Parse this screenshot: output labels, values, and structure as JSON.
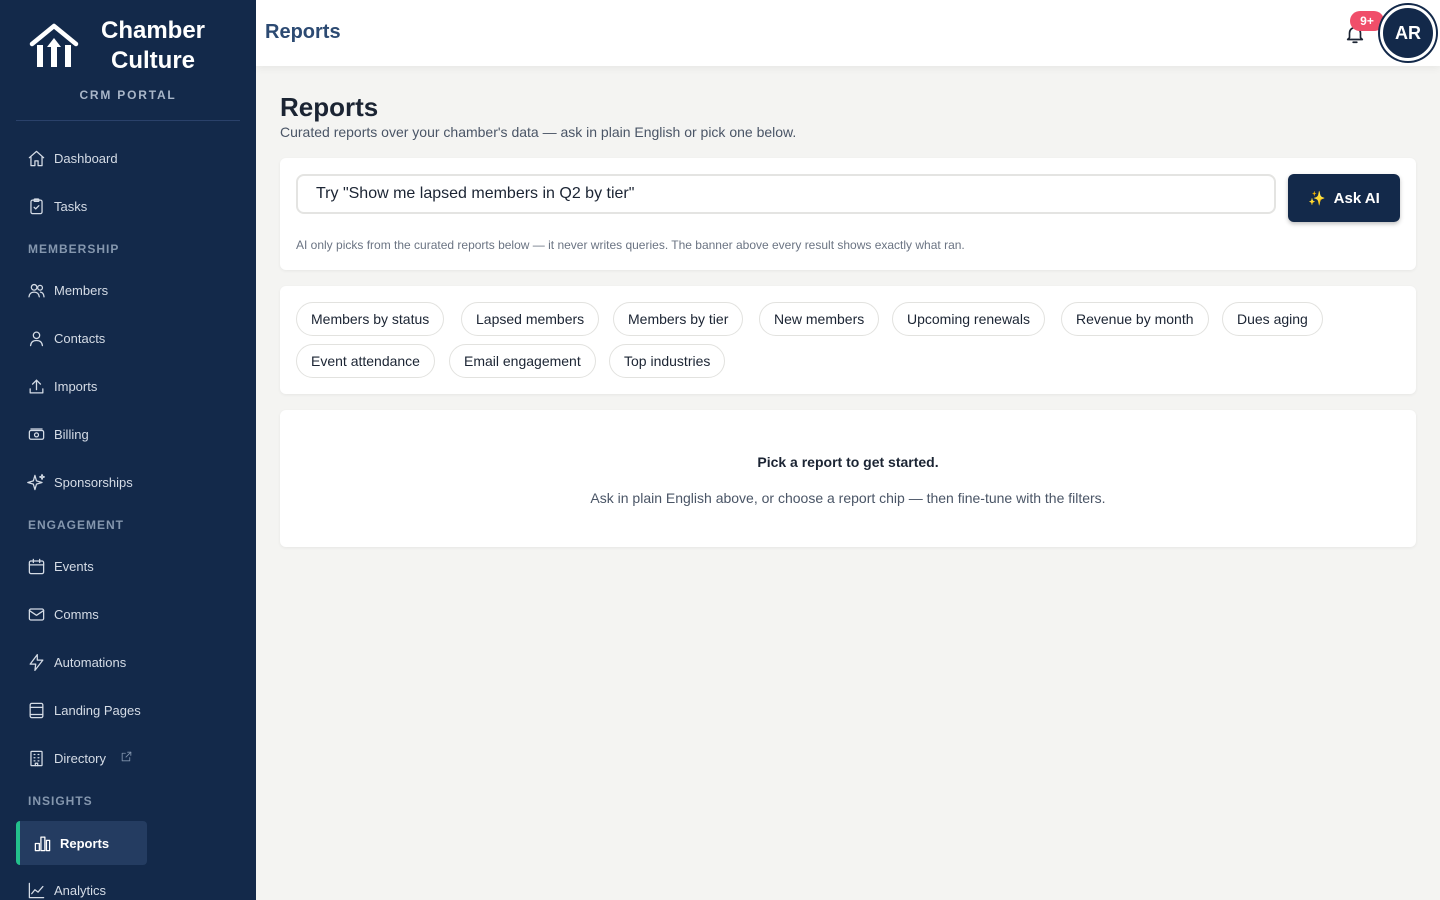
{
  "brand": {
    "name_line1": "Chamber",
    "name_line2": "Culture",
    "subtitle": "CRM PORTAL"
  },
  "sidebar": {
    "items": [
      {
        "label": "Dashboard",
        "icon": "home-icon"
      },
      {
        "label": "Tasks",
        "icon": "clipboard-check-icon"
      },
      {
        "label": "Members",
        "icon": "users-icon"
      },
      {
        "label": "Contacts",
        "icon": "user-icon"
      },
      {
        "label": "Imports",
        "icon": "upload-icon"
      },
      {
        "label": "Billing",
        "icon": "banknote-icon"
      },
      {
        "label": "Sponsorships",
        "icon": "sparkles-icon"
      },
      {
        "label": "Events",
        "icon": "calendar-icon"
      },
      {
        "label": "Comms",
        "icon": "mail-icon"
      },
      {
        "label": "Automations",
        "icon": "zap-icon"
      },
      {
        "label": "Landing Pages",
        "icon": "layout-icon"
      },
      {
        "label": "Directory",
        "icon": "building-icon"
      },
      {
        "label": "Reports",
        "icon": "bar-chart-icon",
        "active": true
      },
      {
        "label": "Analytics",
        "icon": "line-chart-icon"
      }
    ],
    "sections": {
      "membership": "MEMBERSHIP",
      "engagement": "ENGAGEMENT",
      "insights": "INSIGHTS"
    }
  },
  "topbar": {
    "title": "Reports",
    "notification_badge": "9+",
    "avatar_initials": "AR"
  },
  "main": {
    "title": "Reports",
    "subtitle": "Curated reports over your chamber's data — ask in plain English or pick one below.",
    "ask": {
      "value": "Try \"Show me lapsed members in Q2 by tier\"",
      "button_label": "Ask AI",
      "note": "AI only picks from the curated reports below — it never writes queries. The banner above every result shows exactly what ran."
    },
    "chips": [
      "Members by status",
      "Lapsed members",
      "Members by tier",
      "New members",
      "Upcoming renewals",
      "Revenue by month",
      "Dues aging",
      "Event attendance",
      "Email engagement",
      "Top industries"
    ],
    "empty": {
      "title": "Pick a report to get started.",
      "subtitle": "Ask in plain English above, or choose a report chip — then fine-tune with the filters."
    }
  },
  "colors": {
    "sidebar_bg": "#13294a",
    "accent_active": "#23c08c",
    "badge": "#f04e6a",
    "page_bg": "#f4f4f2"
  }
}
